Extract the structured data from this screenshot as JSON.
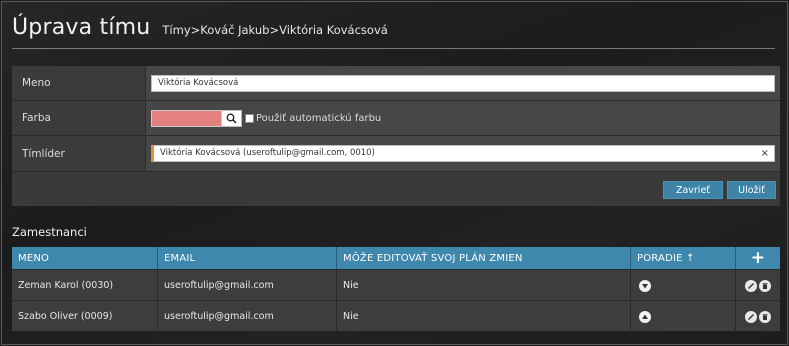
{
  "header": {
    "title": "Úprava tímu",
    "breadcrumb": [
      "Tímy",
      ">",
      "Kováč Jakub",
      ">",
      "Viktória Kovácsová"
    ]
  },
  "form": {
    "name_label": "Meno",
    "name_value": "Viktória Kovácsová",
    "color_label": "Farba",
    "color_value": "#e58081",
    "auto_color_label": "Použiť automatickú farbu",
    "leader_label": "Tímlíder",
    "leader_value": "Viktória Kovácsová (useroftulip@gmail.com, 0010)",
    "close_button": "Zavrieť",
    "save_button": "Uložiť"
  },
  "employees": {
    "section_title": "Zamestnanci",
    "columns": [
      "MENO",
      "EMAIL",
      "MÔŽE EDITOVAŤ SVOJ PLÁN ZMIEN",
      "PORADIE ↑",
      "+"
    ],
    "rows": [
      {
        "name": "Zeman Karol (0030)",
        "email": "useroftulip@gmail.com",
        "can_edit": "Nie",
        "order_icon": "arrow-down-icon"
      },
      {
        "name": "Szabo Oliver (0009)",
        "email": "useroftulip@gmail.com",
        "can_edit": "Nie",
        "order_icon": "arrow-up-icon"
      }
    ]
  },
  "colors": {
    "accent": "#3e87ad",
    "button": "#3c83a6",
    "leader_marker": "#e88e2c"
  }
}
